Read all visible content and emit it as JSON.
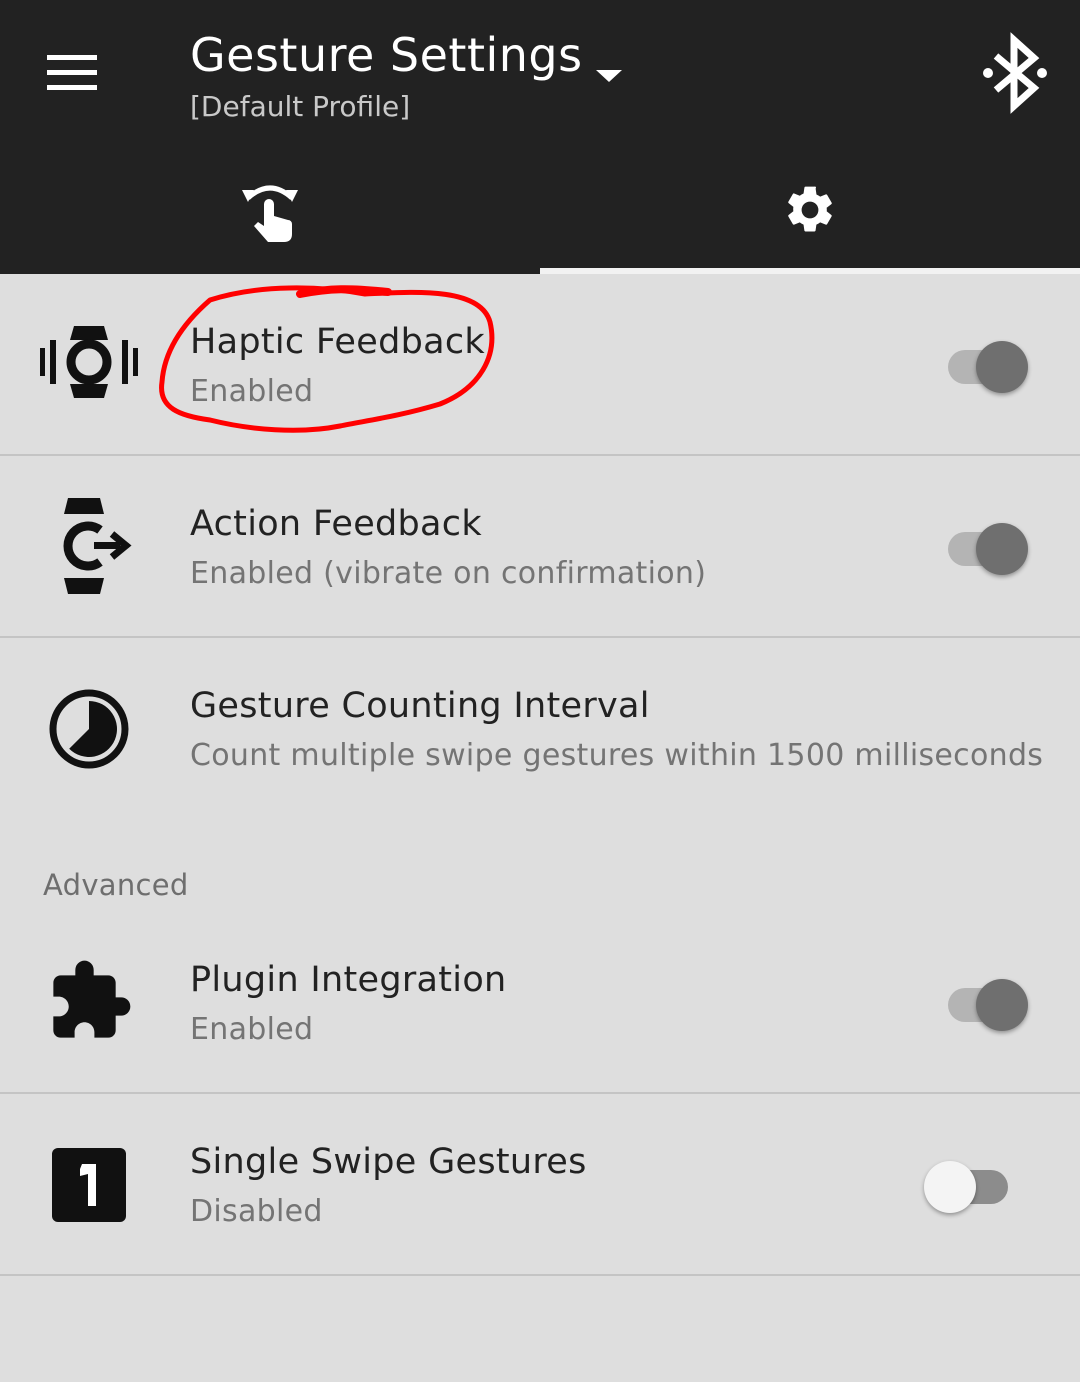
{
  "app_bar": {
    "title": "Gesture Settings",
    "subtitle": "[Default Profile]",
    "icons": {
      "menu": "menu-icon",
      "dropdown": "arrow-drop-down-icon",
      "bluetooth": "bluetooth-searching-icon"
    }
  },
  "tabs": [
    {
      "icon": "touch-gesture-icon",
      "selected": false
    },
    {
      "icon": "gear-icon",
      "selected": true
    }
  ],
  "settings": [
    {
      "icon": "watch-vibration-icon",
      "title": "Haptic Feedback",
      "summary": "Enabled",
      "switch": true
    },
    {
      "icon": "watch-action-icon",
      "title": "Action Feedback",
      "summary": "Enabled (vibrate on confirmation)",
      "switch": true
    },
    {
      "icon": "timelapse-icon",
      "title": "Gesture Counting Interval",
      "summary": "Count multiple swipe gestures within 1500 milliseconds",
      "switch": null
    }
  ],
  "advanced": {
    "header": "Advanced",
    "items": [
      {
        "icon": "puzzle-piece-icon",
        "title": "Plugin Integration",
        "summary": "Enabled",
        "switch": true
      },
      {
        "icon": "numeric-one-box-icon",
        "title": "Single Swipe Gestures",
        "summary": "Disabled",
        "switch": false
      }
    ]
  },
  "colors": {
    "app_bar": "#222222",
    "background": "#dedede",
    "annotation": "#ff0000",
    "switch_on_thumb": "#6f6f6f",
    "switch_off_thumb": "#f4f4f4"
  }
}
